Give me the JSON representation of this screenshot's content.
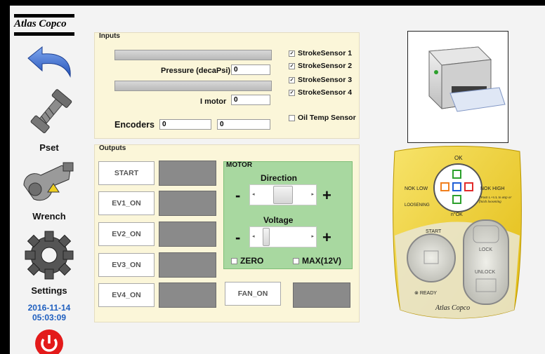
{
  "sidebar": {
    "logo": "Atlas Copco",
    "back_icon": "back-arrow-icon",
    "items": [
      {
        "label": "Pset",
        "icon": "bolt-icon"
      },
      {
        "label": "Wrench",
        "icon": "wrench-icon"
      },
      {
        "label": "Settings",
        "icon": "gear-icon"
      }
    ],
    "date": "2016-11-14",
    "time": "05:03:09",
    "power_icon": "power-icon"
  },
  "inputs": {
    "title": "Inputs",
    "pressure_label": "Pressure (decaPsi)",
    "pressure_value": "0",
    "imotor_label": "I motor",
    "imotor_value": "0",
    "encoders_label": "Encoders",
    "encoder1_value": "0",
    "encoder2_value": "0",
    "sensors": [
      {
        "label": "StrokeSensor 1",
        "checked": true
      },
      {
        "label": "StrokeSensor 2",
        "checked": true
      },
      {
        "label": "StrokeSensor 3",
        "checked": true
      },
      {
        "label": "StrokeSensor 4",
        "checked": true
      }
    ],
    "oil_temp_label": "Oil Temp Sensor",
    "oil_temp_checked": false
  },
  "outputs": {
    "title": "Outputs",
    "buttons": [
      "START",
      "EV1_ON",
      "EV2_ON",
      "EV3_ON",
      "EV4_ON"
    ],
    "fan_label": "FAN_ON"
  },
  "motor": {
    "title": "MOTOR",
    "direction_label": "Direction",
    "voltage_label": "Voltage",
    "minus": "-",
    "plus": "+",
    "zero_label": "ZERO",
    "max_label": "MAX(12V)",
    "direction_level": 0.5,
    "voltage_level": 0.1
  },
  "remote": {
    "ok": "OK",
    "nok_low": "NOK LOW",
    "nok_high": "NOK HIGH",
    "loosening": "LOOSENING",
    "n_ok": "n°OK",
    "note": "*Push L+UL to skip or finish loosening",
    "start": "START",
    "ready": "READY",
    "lock": "LOCK",
    "unlock": "UNLOCK",
    "brand": "Atlas Copco"
  },
  "printer_icon": "printer-icon",
  "colors": {
    "panel": "#fbf6d9",
    "motor": "#a8d8a0",
    "remote_yellow": "#f2d21c",
    "date_blue": "#1f5fbf"
  }
}
